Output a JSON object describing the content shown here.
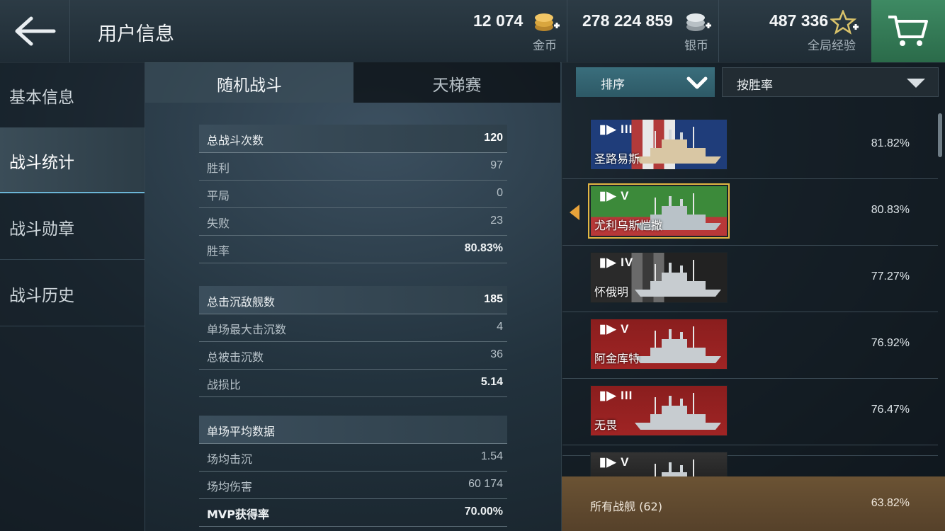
{
  "header": {
    "title": "用户信息",
    "gold": {
      "value": "12 074",
      "label": "金币",
      "icon": "gold-coin-plus-icon"
    },
    "silver": {
      "value": "278 224 859",
      "label": "银币",
      "icon": "silver-coin-plus-icon"
    },
    "xp": {
      "value": "487 336",
      "label": "全局经验",
      "icon": "star-plus-icon"
    },
    "back_icon": "back-arrow-icon",
    "cart_icon": "shopping-cart-icon"
  },
  "sidebar": {
    "items": [
      {
        "label": "基本信息"
      },
      {
        "label": "战斗统计",
        "active": true
      },
      {
        "label": "战斗勋章"
      },
      {
        "label": "战斗历史"
      }
    ]
  },
  "tabs": {
    "random": "随机战斗",
    "ladder": "天梯赛"
  },
  "stats": {
    "groups": [
      {
        "header": {
          "label": "总战斗次数",
          "value": "120"
        },
        "rows": [
          {
            "label": "胜利",
            "value": "97"
          },
          {
            "label": "平局",
            "value": "0"
          },
          {
            "label": "失败",
            "value": "23"
          },
          {
            "label": "胜率",
            "value": "80.83%"
          }
        ]
      },
      {
        "header": {
          "label": "总击沉敌舰数",
          "value": "185"
        },
        "rows": [
          {
            "label": "单场最大击沉数",
            "value": "4"
          },
          {
            "label": "总被击沉数",
            "value": "36"
          },
          {
            "label": "战损比",
            "value": "5.14"
          }
        ]
      },
      {
        "header": {
          "label": "单场平均数据",
          "value": ""
        },
        "rows": [
          {
            "label": "场均击沉",
            "value": "1.54"
          },
          {
            "label": "场均伤害",
            "value": "60 174"
          },
          {
            "label": "MVP获得率",
            "value": "70.00%"
          }
        ]
      }
    ]
  },
  "sort": {
    "button_label": "排序",
    "select_value": "按胜率"
  },
  "ships": [
    {
      "tier": "III",
      "name": "圣路易斯",
      "percent": "81.82%",
      "flag": "usa",
      "hull": "#d9c7a4"
    },
    {
      "tier": "V",
      "name": "尤利乌斯恺撒",
      "percent": "80.83%",
      "flag": "italy",
      "hull": "#b9c2c8",
      "selected": true
    },
    {
      "tier": "IV",
      "name": "怀俄明",
      "percent": "77.27%",
      "flag": "usa-dark",
      "hull": "#c7ccd0"
    },
    {
      "tier": "V",
      "name": "阿金库特",
      "percent": "76.92%",
      "flag": "uk-red",
      "hull": "#c7ccd0"
    },
    {
      "tier": "III",
      "name": "无畏",
      "percent": "76.47%",
      "flag": "uk-red",
      "hull": "#c7ccd0"
    },
    {
      "tier": "V",
      "name": "",
      "percent": "",
      "flag": "dark",
      "hull": "#c7ccd0"
    }
  ],
  "footer": {
    "label": "所有战舰 (62)",
    "value": "63.82%"
  },
  "colors": {
    "accent_green": "#3e8a63",
    "accent_teal": "#3a6e7c",
    "selected_outline": "#e2b743",
    "footer_brown": "#6b5334"
  }
}
